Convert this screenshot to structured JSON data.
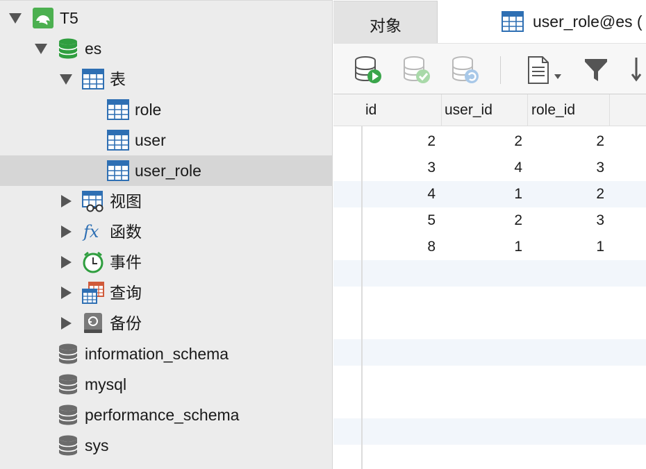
{
  "sidebar": {
    "connection": {
      "label": "T5"
    },
    "database": {
      "label": "es"
    },
    "tables_group": {
      "label": "表"
    },
    "tables": [
      {
        "label": "role"
      },
      {
        "label": "user"
      },
      {
        "label": "user_role",
        "selected": true
      }
    ],
    "groups": [
      {
        "label": "视图",
        "icon": "view-icon"
      },
      {
        "label": "函数",
        "icon": "function-icon"
      },
      {
        "label": "事件",
        "icon": "event-clock-icon"
      },
      {
        "label": "查询",
        "icon": "query-icon"
      },
      {
        "label": "备份",
        "icon": "backup-icon"
      }
    ],
    "other_databases": [
      {
        "label": "information_schema"
      },
      {
        "label": "mysql"
      },
      {
        "label": "performance_schema"
      },
      {
        "label": "sys"
      }
    ]
  },
  "tabs": {
    "objects_label": "对象",
    "active_label": "user_role@es ("
  },
  "toolbar": {
    "buttons": [
      "begin-transaction-icon",
      "commit-icon",
      "rollback-icon",
      "text-view-icon",
      "filter-icon",
      "sort-icon"
    ]
  },
  "grid": {
    "columns": [
      "id",
      "user_id",
      "role_id"
    ],
    "rows": [
      [
        "2",
        "2",
        "2"
      ],
      [
        "3",
        "4",
        "3"
      ],
      [
        "4",
        "1",
        "2"
      ],
      [
        "5",
        "2",
        "3"
      ],
      [
        "8",
        "1",
        "1"
      ]
    ]
  },
  "colors": {
    "sidebar_bg": "#ececec",
    "selected_row": "#d6d6d6",
    "table_icon_blue": "#2e6fb3",
    "db_icon_green": "#2f9e3f",
    "db_icon_gray": "#6b6b6b",
    "alt_row": "#f2f6fb"
  }
}
